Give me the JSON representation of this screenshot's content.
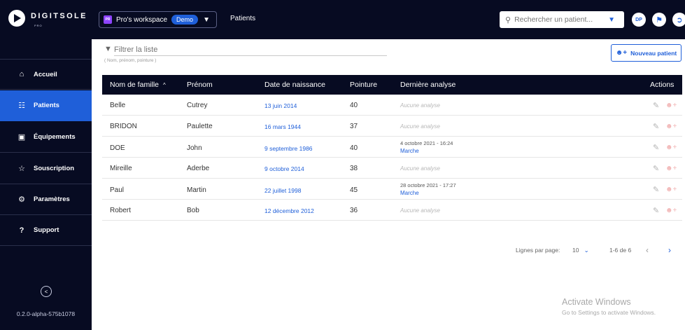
{
  "brand": {
    "name": "DIGITSOLE",
    "sub": "PRO"
  },
  "workspace": {
    "badge": "PR",
    "name": "Pro's workspace",
    "tag": "Demo",
    "chevron": "▼"
  },
  "breadcrumb": "Patients",
  "search": {
    "placeholder": "Rechercher un patient...",
    "icon": "search-icon",
    "chevron": "▼"
  },
  "user": {
    "initials": "DP"
  },
  "sidebar": {
    "items": [
      {
        "label": "Accueil",
        "icon": "⌂"
      },
      {
        "label": "Patients",
        "icon": "☷",
        "active": true
      },
      {
        "label": "Équipements",
        "icon": "▣"
      },
      {
        "label": "Souscription",
        "icon": "☆"
      },
      {
        "label": "Paramètres",
        "icon": "⚙"
      },
      {
        "label": "Support",
        "icon": "?"
      }
    ],
    "version": "0.2.0-alpha-575b1078"
  },
  "filter": {
    "placeholder": "Filtrer la liste",
    "hint": "( Nom, prénom, pointure )"
  },
  "new_patient_label": "Nouveau patient",
  "table": {
    "headers": {
      "lastname": "Nom de famille",
      "firstname": "Prénom",
      "birthdate": "Date de naissance",
      "size": "Pointure",
      "last_analysis": "Dernière analyse",
      "actions": "Actions"
    },
    "sort_indicator": "^",
    "rows": [
      {
        "lastname": "Belle",
        "firstname": "Cutrey",
        "birthdate": "13 juin 2014",
        "size": "40",
        "analysis": "Aucune analyse"
      },
      {
        "lastname": "BRIDON",
        "firstname": "Paulette",
        "birthdate": "16 mars 1944",
        "size": "37",
        "analysis": "Aucune analyse"
      },
      {
        "lastname": "DOE",
        "firstname": "John",
        "birthdate": "9 septembre 1986",
        "size": "40",
        "analysis_date": "4 octobre 2021 - 16:24",
        "analysis_type": "Marche"
      },
      {
        "lastname": "Mireille",
        "firstname": "Aderbe",
        "birthdate": "9 octobre 2014",
        "size": "38",
        "analysis": "Aucune analyse"
      },
      {
        "lastname": "Paul",
        "firstname": "Martin",
        "birthdate": "22 juillet 1998",
        "size": "45",
        "analysis_date": "28 octobre 2021 - 17:27",
        "analysis_type": "Marche"
      },
      {
        "lastname": "Robert",
        "firstname": "Bob",
        "birthdate": "12 décembre 2012",
        "size": "36",
        "analysis": "Aucune analyse"
      }
    ]
  },
  "pagination": {
    "rows_label": "Lignes par page:",
    "rows_value": "10",
    "range": "1-6 de 6"
  },
  "watermark": {
    "title": "Activate Windows",
    "subtitle": "Go to Settings to activate Windows."
  },
  "colors": {
    "navy": "#070b22",
    "accent": "#1f5fd9"
  }
}
